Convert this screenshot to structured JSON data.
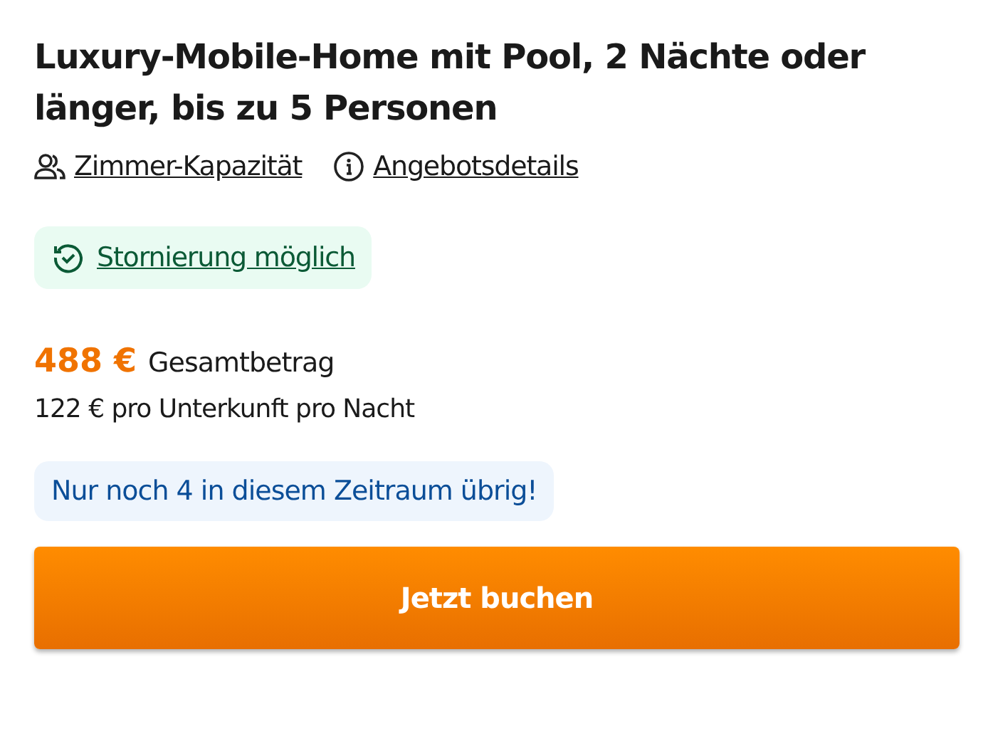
{
  "title": "Luxury-Mobile-Home mit Pool, 2 Nächte oder länger, bis zu 5 Personen",
  "links": [
    {
      "kind": "people",
      "label": "Zimmer-Kapazität"
    },
    {
      "kind": "info",
      "label": "Angebotsdetails"
    }
  ],
  "cancellation": {
    "label": "Stornierung möglich"
  },
  "price": {
    "total": "488 €",
    "total_label": "Gesamtbetrag",
    "per_night": "122 € pro Unterkunft pro Nacht"
  },
  "availability": "Nur noch 4 in diesem Zeitraum übrig!",
  "book_button": "Jetzt buchen"
}
